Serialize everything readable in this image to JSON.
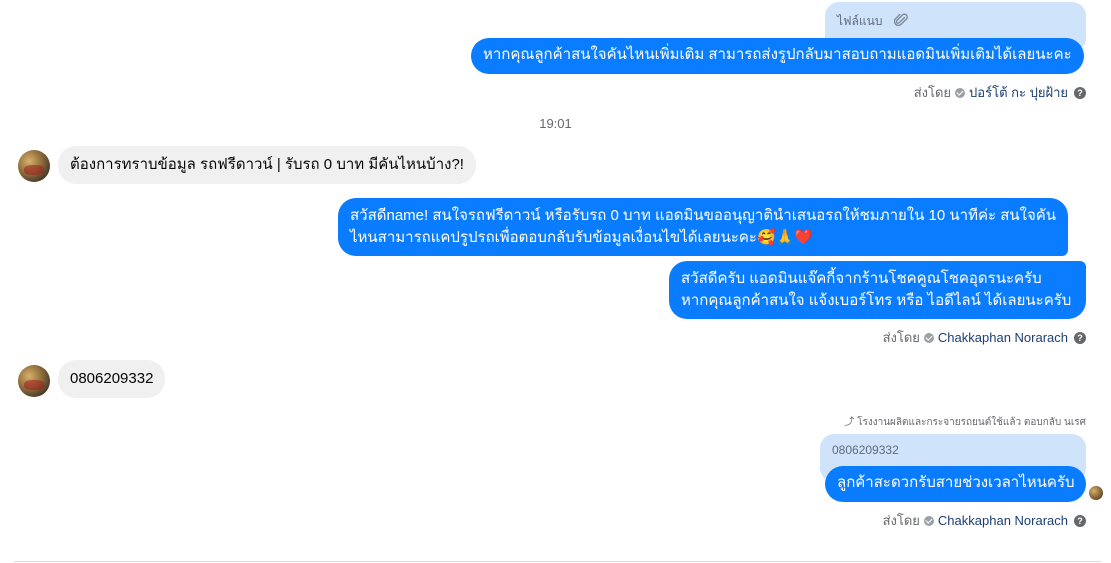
{
  "messages": {
    "attachment_reply": {
      "label": "ไฟล์แนบ",
      "icon": "paperclip-icon"
    },
    "out_1": "หากคุณลูกค้าสนใจคันไหนเพิ่มเติม สามารถส่งรูปกลับมาสอบถามแอดมินเพิ่มเติมได้เลยนะคะ",
    "sent_by_1": {
      "prefix": "ส่งโดย",
      "name": "ปอร์โต้ กะ ปุยฝ้าย"
    },
    "time_divider": "19:01",
    "in_1": "ต้องการทราบข้อมูล รถฟรีดาวน์ | รับรถ 0 บาท มีคันไหนบ้าง?!",
    "out_2_line1": "สวัสดีname! สนใจรถฟรีดาวน์ หรือรับรถ 0 บาท แอดมินขออนุญาตินำเสนอรถให้ชมภายใน 10 นาทีค่ะ สนใจคัน",
    "out_2_line2": "ไหนสามารถแคปรูปรถเพื่อตอบกลับรับข้อมูลเงื่อนไขได้เลยนะคะ🥰🙏❤️",
    "out_3_line1": "สวัสดีครับ แอดมินแจ๊คกี้จากร้านโชคคูณโชคอุดรนะครับ",
    "out_3_line2": "หากคุณลูกค้าสนใจ แจ้งเบอร์โทร หรือ ไอดีไลน์ ได้เลยนะครับ",
    "sent_by_2": {
      "prefix": "ส่งโดย",
      "name": "Chakkaphan Norarach"
    },
    "in_2": "0806209332",
    "reply_hint": "โรงงานผลิตและกระจายรถยนต์ใช้แล้ว ตอบกลับ นเรศ",
    "quoted": "0806209332",
    "out_4": "ลูกค้าสะดวกรับสายช่วงเวลาไหนครับ",
    "sent_by_3": {
      "prefix": "ส่งโดย",
      "name": "Chakkaphan Norarach"
    }
  },
  "colors": {
    "outgoing_bubble": "#0a7cff",
    "incoming_bubble": "#f0f0f0",
    "quoted_bubble": "#cfe3fb",
    "sender_name": "#1c3f73"
  }
}
